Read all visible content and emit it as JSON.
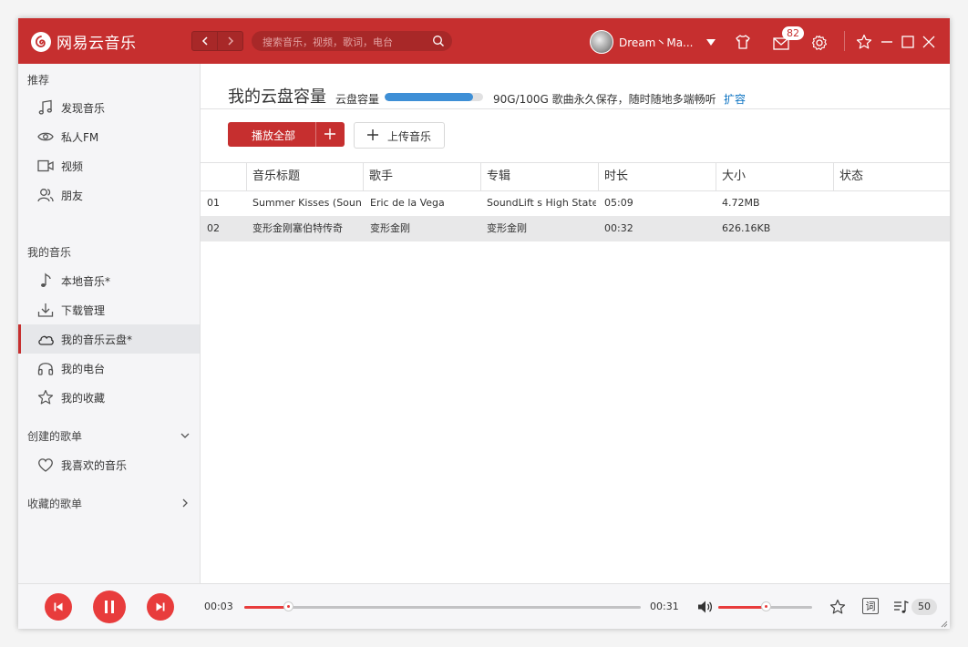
{
  "app": {
    "name": "网易云音乐",
    "logo_glyph": "网"
  },
  "titlebar": {
    "back_glyph": "‹",
    "forward_glyph": "›",
    "search_placeholder": "搜索音乐，视频，歌词，电台",
    "username": "Dream丶Ma...",
    "mail_count": "82"
  },
  "sidebar": {
    "section_recommend": "推荐",
    "recommend_items": [
      {
        "label": "发现音乐",
        "icon": "music-note-icon"
      },
      {
        "label": "私人FM",
        "icon": "eye-icon"
      },
      {
        "label": "视频",
        "icon": "video-icon"
      },
      {
        "label": "朋友",
        "icon": "friends-icon"
      }
    ],
    "section_my_music": "我的音乐",
    "my_music_items": [
      {
        "label": "本地音乐*",
        "icon": "single-note-icon"
      },
      {
        "label": "下载管理",
        "icon": "download-icon"
      },
      {
        "label": "我的音乐云盘*",
        "icon": "cloud-icon",
        "active": true
      },
      {
        "label": "我的电台",
        "icon": "headphones-icon"
      },
      {
        "label": "我的收藏",
        "icon": "star-icon"
      }
    ],
    "section_created": "创建的歌单",
    "created_items": [
      {
        "label": "我喜欢的音乐",
        "icon": "heart-icon"
      }
    ],
    "section_collected": "收藏的歌单"
  },
  "main": {
    "title": "我的云盘容量",
    "capacity_label": "云盘容量",
    "capacity_fraction": 0.9,
    "capacity_text": "90G/100G 歌曲永久保存，随时随地多端畅听",
    "expand_link": "扩容",
    "play_all_label": "播放全部",
    "upload_label": "上传音乐",
    "columns": [
      "音乐标题",
      "歌手",
      "专辑",
      "时长",
      "大小",
      "状态"
    ],
    "rows": [
      {
        "index": "01",
        "title": "Summer Kisses (Sound",
        "artist": "Eric de la Vega",
        "album": "SoundLift s High State",
        "duration": "05:09",
        "size": "4.72MB",
        "status": ""
      },
      {
        "index": "02",
        "title": "变形金刚塞伯特传奇",
        "artist": "变形金刚",
        "album": "变形金刚",
        "duration": "00:32",
        "size": "626.16KB",
        "status": ""
      }
    ]
  },
  "player": {
    "current_time": "00:03",
    "total_time": "00:31",
    "progress_fraction": 0.11,
    "volume_fraction": 0.5,
    "lyric_label": "词",
    "playlist_count": "50"
  },
  "colors": {
    "brand_red": "#c62f2f",
    "player_red": "#e83c3c",
    "capacity_blue": "#3e8fd6",
    "link_blue": "#0c73c2"
  }
}
